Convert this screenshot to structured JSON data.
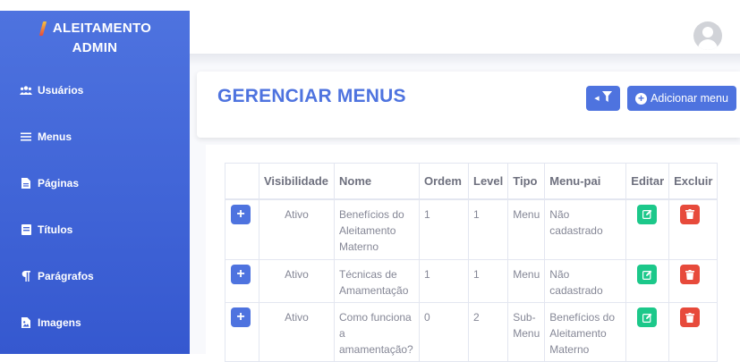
{
  "sidebar": {
    "brand_line1": "ALEITAMENTO",
    "brand_line2": "ADMIN",
    "items": [
      {
        "label": "Usuários",
        "icon": "users-icon"
      },
      {
        "label": "Menus",
        "icon": "bars-icon"
      },
      {
        "label": "Páginas",
        "icon": "file-icon"
      },
      {
        "label": "Títulos",
        "icon": "heading-icon"
      },
      {
        "label": "Parágrafos",
        "icon": "paragraph-icon"
      },
      {
        "label": "Imagens",
        "icon": "image-file-icon"
      }
    ]
  },
  "header": {
    "title": "GERENCIAR MENUS",
    "add_button": "Adicionar menu"
  },
  "table": {
    "columns": [
      "",
      "Visibilidade",
      "Nome",
      "Ordem",
      "Level",
      "Tipo",
      "Menu-pai",
      "Editar",
      "Excluir"
    ],
    "rows": [
      {
        "visibilidade": "Ativo",
        "nome": "Benefícios do Aleitamento Materno",
        "ordem": "1",
        "level": "1",
        "tipo": "Menu",
        "menu_pai": "Não cadastrado"
      },
      {
        "visibilidade": "Ativo",
        "nome": "Técnicas de Amamentação",
        "ordem": "1",
        "level": "1",
        "tipo": "Menu",
        "menu_pai": "Não cadastrado"
      },
      {
        "visibilidade": "Ativo",
        "nome": "Como funciona a amamentação?",
        "ordem": "0",
        "level": "2",
        "tipo": "Sub-Menu",
        "menu_pai": "Benefícios do Aleitamento Materno"
      }
    ]
  },
  "colors": {
    "primary": "#4e73df",
    "success": "#1cc88a",
    "danger": "#e74a3b"
  }
}
